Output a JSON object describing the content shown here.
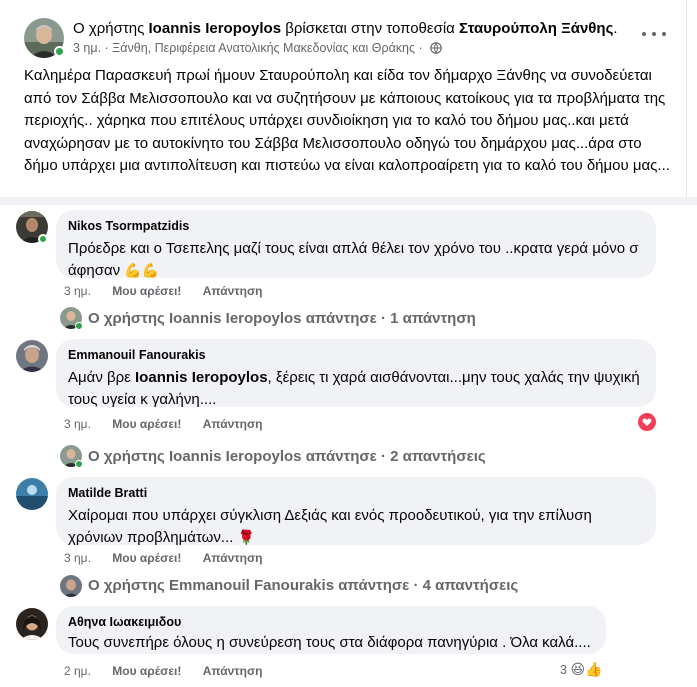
{
  "post": {
    "author_prefix": "Ο χρήστης",
    "author": "Ioannis Ieropoylos",
    "location_text": "βρίσκεται στην τοποθεσία",
    "location": "Σταυρούπολη Ξάνθης",
    "location_suffix": ".",
    "meta": "3 ημ. · Ξάνθη, Περιφέρεια Ανατολικής Μακεδονίας και Θράκης ·",
    "body": "Καλημέρα  Παρασκευή πρωί ήμουν Σταυρούπολη και είδα τον δήμαρχο Ξάνθης να συνοδεύεται από τον Σάββα  Μελισσοπουλο και να συζητήσουν με κάποιους κατοίκους για τα προβλήματα της περιοχής.. χάρηκα που επιτέλους υπάρχει συνδιοίκηση για το καλό του δήμου μας..και μετά αναχώρησαν με το αυτοκίνητο του Σάββα Μελισσοπουλο οδηγώ του δημάρχου μας...άρα στο δήμο υπάρχει μια αντιπολίτευση και πιστεύω να είναι καλοπροαίρετη για το καλό του δήμου μας..."
  },
  "labels": {
    "like": "Μου αρέσει!",
    "reply": "Απάντηση"
  },
  "comments": [
    {
      "author": "Nikos Tsormpatzidis",
      "text": "Πρόεδρε και ο Τσεπελης μαζί τους είναι απλά θέλει τον χρόνο του ..κρατα γερά μόνο σ άφησαν",
      "emoji": "💪💪",
      "time": "3 ημ.",
      "reply_summary": "Ο χρήστης Ioannis Ieropoylos απάντησε · 1 απάντηση"
    },
    {
      "author": "Emmanouil Fanourakis",
      "text_before": "Αμάν βρε ",
      "mention": "Ioannis Ieropoylos",
      "text_after": ", ξέρεις τι χαρά αισθάνονται...μην τους χαλάς την ψυχική τους υγεία κ γαλήνη....",
      "time": "3 ημ.",
      "reaction": "heart",
      "reply_summary": "Ο χρήστης Ioannis Ieropoylos απάντησε · 2 απαντήσεις"
    },
    {
      "author": "Matilde Bratti",
      "text": "Χαίρομαι που υπάρχει σύγκλιση Δεξιάς και ενός προοδευτικού, για την επίλυση χρόνιων προβλημάτων...",
      "emoji": "🌹",
      "time": "3 ημ.",
      "reply_summary": "Ο χρήστης Emmanouil Fanourakis απάντησε · 4 απαντήσεις"
    },
    {
      "author": "Αθηνα Ιωακειμιδου",
      "text": "Τους συνεπήρε όλους η συνεύρεση τους στα διάφορα πανηγύρια . Όλα καλά....",
      "time": "2 ημ.",
      "reaction_count": "3",
      "reaction_emojis": "😆👍"
    }
  ],
  "colors": {
    "online": "#31a24c",
    "bubble": "#f0f2f5",
    "muted": "#65676b",
    "heart": "#f33e58"
  }
}
